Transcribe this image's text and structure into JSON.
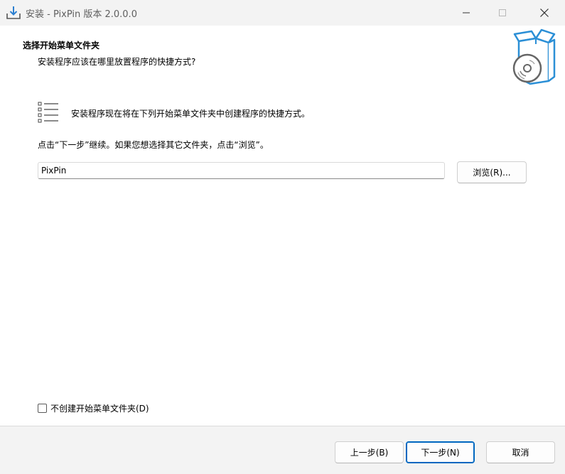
{
  "window": {
    "title": "安装 - PixPin 版本 2.0.0.0",
    "icons": {
      "app": "install-download-icon",
      "minimize": "minimize-icon",
      "maximize": "maximize-icon",
      "close": "close-icon"
    }
  },
  "header": {
    "title": "选择开始菜单文件夹",
    "subtitle": "安装程序应该在哪里放置程序的快捷方式?",
    "image": "software-box-disc-icon"
  },
  "content": {
    "instruction": "安装程序现在将在下列开始菜单文件夹中创建程序的快捷方式。",
    "hint": "点击“下一步”继续。如果您想选择其它文件夹，点击“浏览”。",
    "folder_value": "PixPin",
    "browse_label": "浏览(R)...",
    "no_menu_checkbox_label": "不创建开始菜单文件夹(D)",
    "no_menu_checked": false
  },
  "footer": {
    "back_label": "上一步(B)",
    "next_label": "下一步(N)",
    "cancel_label": "取消"
  },
  "colors": {
    "accent": "#0067c0",
    "box_blue": "#2b8fd6"
  }
}
